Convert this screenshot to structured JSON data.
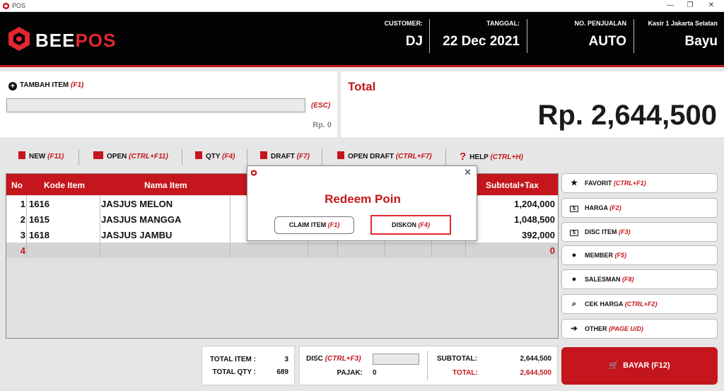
{
  "window": {
    "title": "POS",
    "minimize": "—",
    "restore": "❐",
    "close": "✕"
  },
  "brand": {
    "name_part1": "BEE",
    "name_part2": "POS",
    "accent_color": "#c4161c"
  },
  "header": {
    "customer_label": "CUSTOMER:",
    "customer": "DJ",
    "date_label": "TANGGAL:",
    "date": "22 Dec 2021",
    "sale_no_label": "NO. PENJUALAN",
    "sale_no": "AUTO",
    "cashier_label": "Kasir 1 Jakarta Selatan",
    "cashier": "Bayu"
  },
  "add_item": {
    "label": "TAMBAH ITEM",
    "hotkey": "(F1)",
    "value": "",
    "esc": "(ESC)",
    "price": "Rp. 0"
  },
  "total": {
    "label": "Total",
    "value": "Rp. 2,644,500"
  },
  "toolbar": [
    {
      "label": "NEW",
      "hotkey": "(F11)",
      "icon": "file-icon"
    },
    {
      "label": "OPEN",
      "hotkey": "(CTRL+F11)",
      "icon": "folder-icon"
    },
    {
      "label": "QTY",
      "hotkey": "(F4)",
      "icon": "qty-icon"
    },
    {
      "label": "DRAFT",
      "hotkey": "(F7)",
      "icon": "save-icon"
    },
    {
      "label": "OPEN DRAFT",
      "hotkey": "(CTRL+F7)",
      "icon": "save-icon"
    },
    {
      "label": "HELP",
      "hotkey": "(CTRL+H)",
      "icon": "help-icon"
    }
  ],
  "table": {
    "columns": {
      "no": "No",
      "code": "Kode Item",
      "name": "Nama Item",
      "subtotal": "Subtotal+Tax"
    },
    "rows": [
      {
        "no": "1",
        "code": "1616",
        "name": "JASJUS MELON",
        "subtotal": "1,204,000"
      },
      {
        "no": "2",
        "code": "1615",
        "name": "JASJUS MANGGA",
        "subtotal": "1,048,500"
      },
      {
        "no": "3",
        "code": "1618",
        "name": "JASJUS JAMBU",
        "subtotal": "392,000"
      },
      {
        "no": "4",
        "code": "",
        "name": "",
        "subtotal": "0"
      }
    ]
  },
  "sidebar": [
    {
      "label": "FAVORIT",
      "hotkey": "(CTRL+F1)",
      "icon": "star-icon",
      "glyph": "★"
    },
    {
      "label": "HARGA",
      "hotkey": "(F2)",
      "icon": "price-tag-icon",
      "glyph": "$"
    },
    {
      "label": "DISC ITEM",
      "hotkey": "(F3)",
      "icon": "discount-icon",
      "glyph": "$"
    },
    {
      "label": "MEMBER",
      "hotkey": "(F5)",
      "icon": "user-icon",
      "glyph": "●"
    },
    {
      "label": "SALESMAN",
      "hotkey": "(F8)",
      "icon": "salesman-icon",
      "glyph": "●"
    },
    {
      "label": "CEK HARGA",
      "hotkey": "(CTRL+F2)",
      "icon": "search-icon",
      "glyph": "⌕"
    },
    {
      "label": "OTHER",
      "hotkey": "(PAGE U/D)",
      "icon": "arrow-right-icon",
      "glyph": "➔"
    }
  ],
  "summary": {
    "total_item_label": "TOTAL ITEM :",
    "total_item": "3",
    "total_qty_label": "TOTAL QTY :",
    "total_qty": "689",
    "disc_label": "DISC",
    "disc_hotkey": "(CTRL+F3)",
    "disc_value": "",
    "tax_label": "PAJAK:",
    "tax": "0",
    "subtotal_label": "SUBTOTAL:",
    "subtotal": "2,644,500",
    "total_label": "TOTAL:",
    "total": "2,644,500"
  },
  "pay_button": {
    "label": "BAYAR (F12)",
    "icon": "cart-icon",
    "glyph": "🛒"
  },
  "modal": {
    "title": "Redeem Poin",
    "close": "✕",
    "claim_label": "CLAIM ITEM",
    "claim_hotkey": "(F1)",
    "discount_label": "DISKON",
    "discount_hotkey": "(F4)"
  }
}
